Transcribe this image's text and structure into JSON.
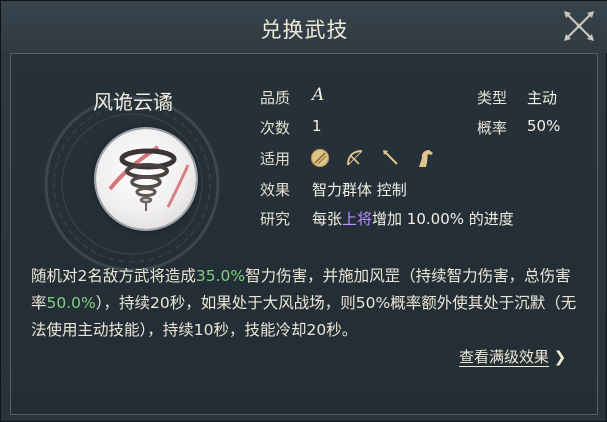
{
  "window": {
    "title": "兑换武技"
  },
  "skill": {
    "name": "风诡云谲"
  },
  "attributes": {
    "quality_label": "品质",
    "quality_value": "A",
    "count_label": "次数",
    "count_value": "1",
    "suitable_label": "适用",
    "effect_label": "效果",
    "effect_value": "智力群体 控制",
    "research_label": "研究",
    "research_prefix": "每张",
    "research_highlight": "上将",
    "research_suffix": "增加 10.00% 的进度",
    "type_label": "类型",
    "type_value": "主动",
    "rate_label": "概率",
    "rate_value": "50%"
  },
  "suitable_icons": [
    "shield-icon",
    "bow-icon",
    "spear-icon",
    "horse-icon"
  ],
  "description": {
    "p1": "随机对2名敌方武将造成",
    "v1": "35.0%",
    "p2": "智力伤害，并施加风罡（持续智力伤害，总伤害率",
    "v2": "50.0%",
    "p3": "），持续20秒，如果处于大风战场，则50%概率额外使其处于沉默（无法使用主动技能），持续10秒，技能冷却20秒。"
  },
  "actions": {
    "view_max": "查看满级效果",
    "view_max_arrow": "❯"
  },
  "colors": {
    "highlight": "#b992ff",
    "percent": "#7fd07f"
  }
}
